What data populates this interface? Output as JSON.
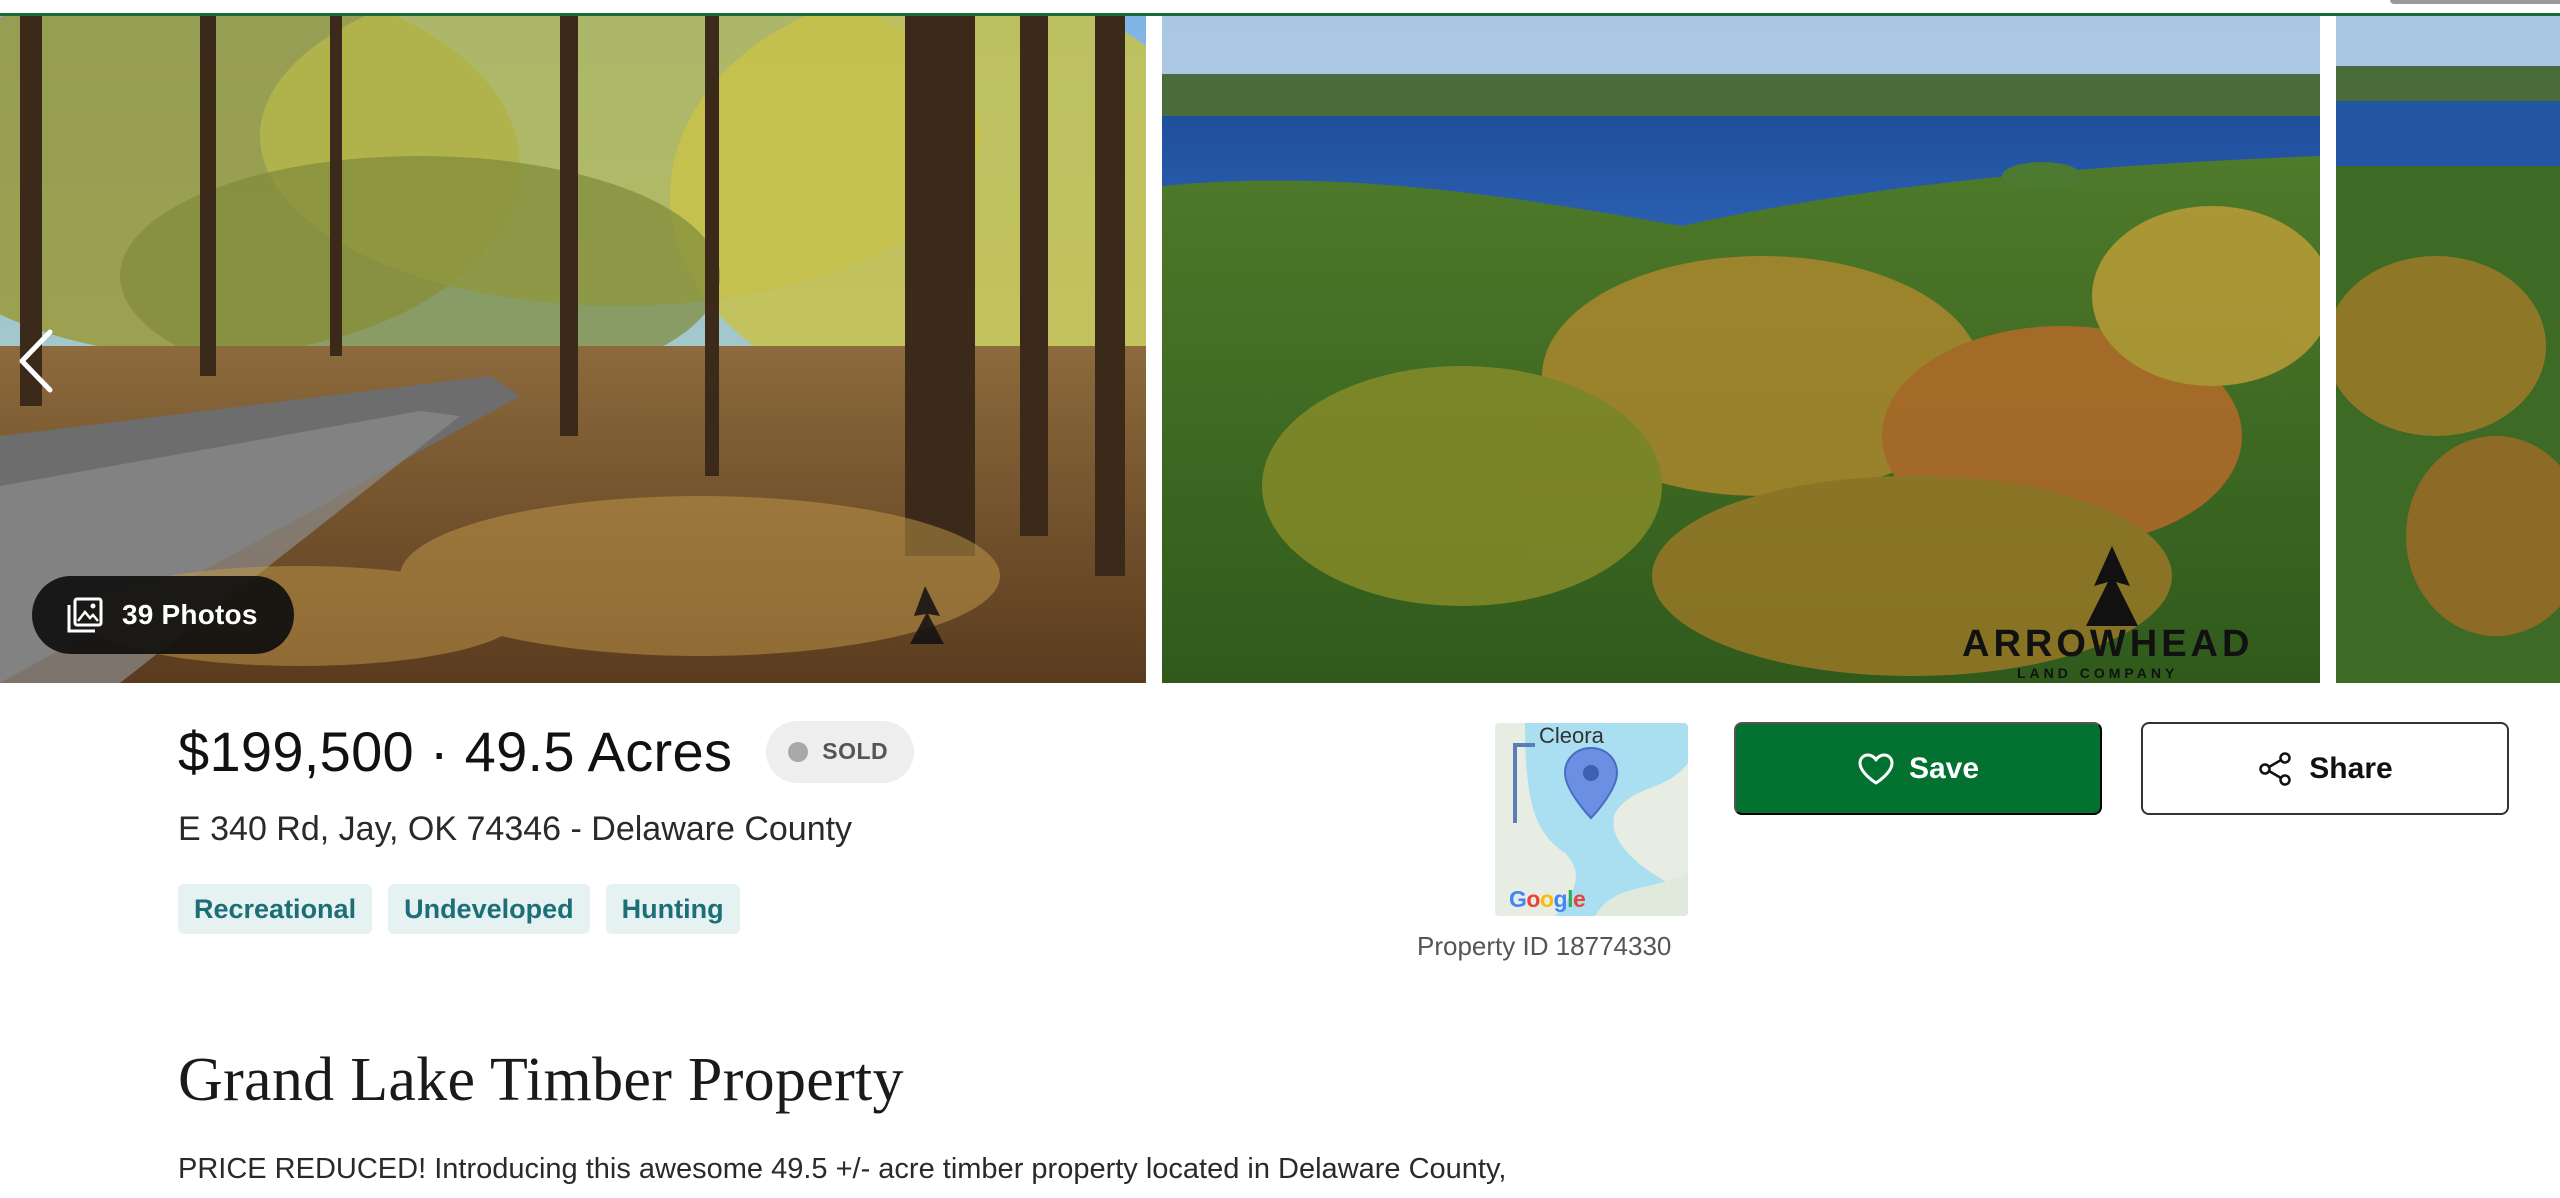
{
  "gallery": {
    "photo_count_label": "39 Photos",
    "photos": [
      {
        "alt": "Forest road with autumn trees"
      },
      {
        "alt": "Aerial view of lake and forest"
      },
      {
        "alt": "Aerial view of forest"
      }
    ],
    "watermark": {
      "brand": "ARROWHEAD",
      "sub": "LAND COMPANY"
    }
  },
  "listing": {
    "price_acres": "$199,500 · 49.5 Acres",
    "status": "SOLD",
    "address": "E 340 Rd, Jay, OK 74346 - Delaware County",
    "tags": [
      "Recreational",
      "Undeveloped",
      "Hunting"
    ],
    "property_id": "Property ID 18774330",
    "map": {
      "city_label": "Cleora",
      "provider": "Google"
    },
    "title": "Grand Lake Timber Property",
    "description": "PRICE REDUCED! Introducing this awesome 49.5 +/- acre timber property located in Delaware County,"
  },
  "actions": {
    "save_label": "Save",
    "share_label": "Share"
  },
  "colors": {
    "brand_green": "#037130",
    "tag_bg": "#e6f1f2",
    "tag_text": "#1c6f77",
    "accent_line": "#1a6b35"
  },
  "icons": {
    "prev": "chevron-left-icon",
    "photos": "gallery-icon",
    "save": "heart-icon",
    "share": "share-icon",
    "map_pin": "map-pin-icon"
  }
}
